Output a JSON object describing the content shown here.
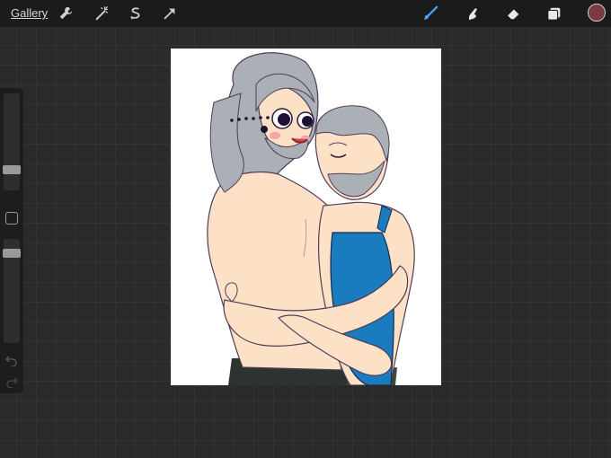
{
  "toolbar": {
    "gallery_label": "Gallery",
    "left_tools": [
      {
        "icon": "wrench-icon"
      },
      {
        "icon": "magic-wand-icon"
      },
      {
        "icon": "selection-icon"
      },
      {
        "icon": "transform-arrow-icon"
      }
    ],
    "right_tools": [
      {
        "icon": "brush-icon",
        "active": true
      },
      {
        "icon": "smudge-icon"
      },
      {
        "icon": "eraser-icon"
      },
      {
        "icon": "layers-icon"
      }
    ],
    "current_color": "#7a3b3f",
    "accent_color": "#4aa3ff"
  },
  "sidebar": {
    "brush_size": 0.18,
    "opacity": 0.9,
    "undo_icon": "undo-icon",
    "redo_icon": "redo-icon"
  },
  "canvas": {
    "description_icon": "artwork"
  }
}
